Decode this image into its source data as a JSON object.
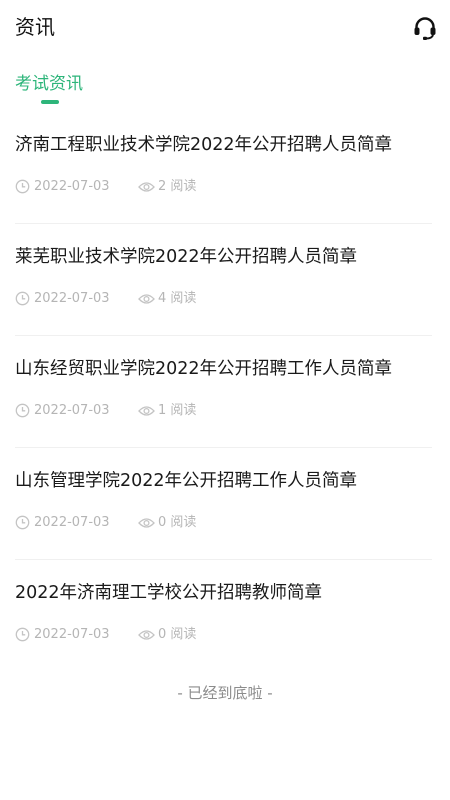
{
  "header": {
    "title": "资讯",
    "support_icon": "headset-icon"
  },
  "tabs": [
    {
      "label": "考试资讯",
      "active": true
    }
  ],
  "accent_color": "#2db57a",
  "articles": [
    {
      "title": "济南工程职业技术学院2022年公开招聘人员简章",
      "date": "2022-07-03",
      "views": "2 阅读"
    },
    {
      "title": "莱芜职业技术学院2022年公开招聘人员简章",
      "date": "2022-07-03",
      "views": "4 阅读"
    },
    {
      "title": "山东经贸职业学院2022年公开招聘工作人员简章",
      "date": "2022-07-03",
      "views": "1 阅读"
    },
    {
      "title": "山东管理学院2022年公开招聘工作人员简章",
      "date": "2022-07-03",
      "views": "0 阅读"
    },
    {
      "title": "2022年济南理工学校公开招聘教师简章",
      "date": "2022-07-03",
      "views": "0 阅读"
    }
  ],
  "footer": {
    "text": "- 已经到底啦 -"
  }
}
